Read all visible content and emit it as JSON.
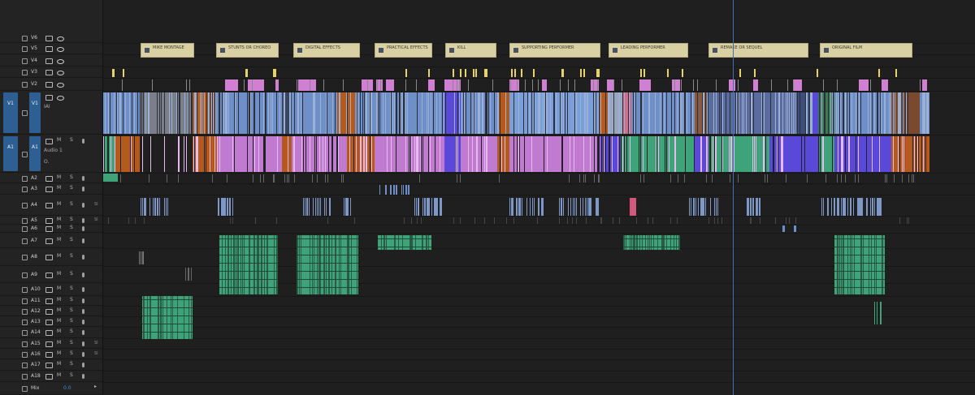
{
  "tracks": [
    {
      "id": "V6",
      "patch": ""
    },
    {
      "id": "V5",
      "patch": ""
    },
    {
      "id": "V4",
      "patch": ""
    },
    {
      "id": "V3",
      "patch": ""
    },
    {
      "id": "V2",
      "patch": ""
    },
    {
      "id": "V1",
      "patch": "V1",
      "sub": "IAI"
    },
    {
      "id": "A1",
      "patch": "A1",
      "sub": "Audio 1",
      "sub2": "O."
    },
    {
      "id": "A2"
    },
    {
      "id": "A3"
    },
    {
      "id": "A4"
    },
    {
      "id": "A5"
    },
    {
      "id": "A6"
    },
    {
      "id": "A7"
    },
    {
      "id": "A8"
    },
    {
      "id": "A9"
    },
    {
      "id": "A10"
    },
    {
      "id": "A11"
    },
    {
      "id": "A12"
    },
    {
      "id": "A13"
    },
    {
      "id": "A14"
    },
    {
      "id": "A15"
    },
    {
      "id": "A16"
    },
    {
      "id": "A17"
    },
    {
      "id": "A18"
    }
  ],
  "labels": {
    "m": "M",
    "s": "S",
    "si": "SI",
    "mix": "Mix",
    "mix_value": "0.0"
  },
  "markers": [
    {
      "label": "MIKE MONTAGE"
    },
    {
      "label": "STUNTS OR CHOREO"
    },
    {
      "label": "DIGITAL EFFECTS"
    },
    {
      "label": "PRACTICAL EFFECTS"
    },
    {
      "label": "KILL"
    },
    {
      "label": "SUPPORTING PERFORMER"
    },
    {
      "label": "LEADING PERFORMER"
    },
    {
      "label": "REMAKE OR SEQUEL"
    },
    {
      "label": "ORIGINAL FILM"
    }
  ],
  "colors": {
    "video_blue": "#6f8fc9",
    "orange": "#b35a1c",
    "pink": "#d07fd2",
    "green": "#3fa37a",
    "violet": "#5a48d8",
    "yellow": "#e6d46a",
    "marker_bg": "#d9d0a3",
    "playhead": "#3f6fae"
  }
}
